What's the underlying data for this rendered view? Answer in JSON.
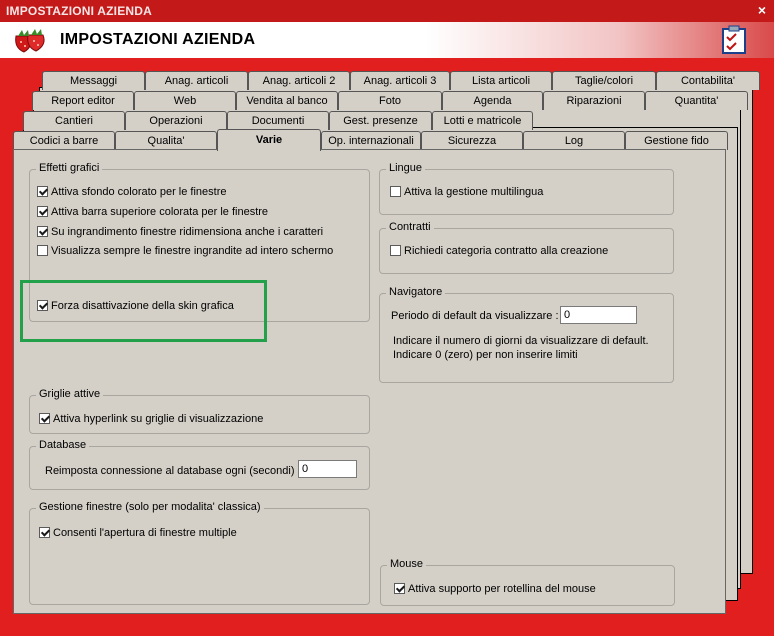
{
  "window": {
    "title": "IMPOSTAZIONI AZIENDA",
    "close_label": "×"
  },
  "header": {
    "title": "IMPOSTAZIONI AZIENDA",
    "logo_icon": "strawberry-icon",
    "notes_icon": "checklist-icon"
  },
  "tabs": {
    "row1": [
      "Messaggi",
      "Anag. articoli",
      "Anag. articoli 2",
      "Anag. articoli 3",
      "Lista articoli",
      "Taglie/colori",
      "Contabilita'"
    ],
    "row2": [
      "Report editor",
      "Web",
      "Vendita al banco",
      "Foto",
      "Agenda",
      "Riparazioni",
      "Quantita'"
    ],
    "row3": [
      "Cantieri",
      "Operazioni",
      "Documenti",
      "Gest. presenze",
      "Lotti e matricole"
    ],
    "row4": [
      "Codici a barre",
      "Qualita'",
      "Varie",
      "Op. internazionali",
      "Sicurezza",
      "Log",
      "Gestione fido"
    ],
    "active": "Varie"
  },
  "effetti": {
    "legend": "Effetti grafici",
    "items": [
      {
        "label": "Attiva sfondo colorato per le finestre",
        "checked": true
      },
      {
        "label": "Attiva barra superiore colorata per le finestre",
        "checked": true
      },
      {
        "label": "Su ingrandimento finestre ridimensiona anche i caratteri",
        "checked": true
      },
      {
        "label": "Visualizza sempre le finestre ingrandite ad intero schermo",
        "checked": false
      },
      {
        "label": "Forza disattivazione della skin grafica",
        "checked": true
      }
    ]
  },
  "griglie": {
    "legend": "Griglie attive",
    "item": {
      "label": "Attiva hyperlink su griglie di visualizzazione",
      "checked": true
    }
  },
  "database": {
    "legend": "Database",
    "label": "Reimposta connessione al database ogni (secondi) :",
    "value": "0"
  },
  "gestione": {
    "legend": "Gestione finestre (solo per modalita' classica)",
    "item": {
      "label": "Consenti l'apertura di finestre multiple",
      "checked": true
    }
  },
  "lingue": {
    "legend": "Lingue",
    "item": {
      "label": "Attiva la gestione multilingua",
      "checked": false
    }
  },
  "contratti": {
    "legend": "Contratti",
    "item": {
      "label": "Richiedi categoria contratto alla creazione",
      "checked": false
    }
  },
  "navigatore": {
    "legend": "Navigatore",
    "label": "Periodo di default da visualizzare :",
    "value": "0",
    "note1": "Indicare il numero di giorni da visualizzare di default.",
    "note2": "Indicare 0 (zero) per non inserire limiti"
  },
  "mouse": {
    "legend": "Mouse",
    "item": {
      "label": "Attiva supporto per rotellina del mouse",
      "checked": true
    }
  }
}
